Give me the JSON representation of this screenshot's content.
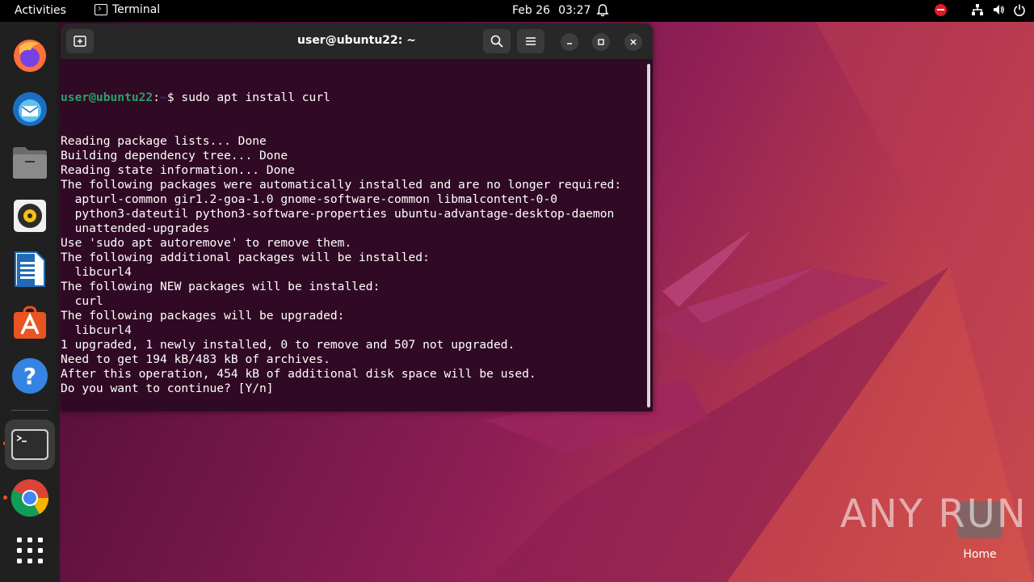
{
  "topbar": {
    "activities": "Activities",
    "app_name": "Terminal",
    "date": "Feb 26",
    "time": "03:27"
  },
  "dock": {
    "items": [
      "firefox-icon",
      "thunderbird-icon",
      "files-icon",
      "rhythmbox-icon",
      "libreoffice-writer-icon",
      "app-center-icon",
      "help-icon",
      "terminal-icon",
      "chrome-icon",
      "show-apps-icon"
    ]
  },
  "terminal": {
    "title": "user@ubuntu22: ~",
    "prompt_user": "user@ubuntu22",
    "prompt_sep": ":",
    "prompt_path": "~",
    "prompt_symbol": "$ ",
    "command": "sudo apt install curl",
    "output": [
      "Reading package lists... Done",
      "Building dependency tree... Done",
      "Reading state information... Done",
      "The following packages were automatically installed and are no longer required:",
      "  apturl-common gir1.2-goa-1.0 gnome-software-common libmalcontent-0-0",
      "  python3-dateutil python3-software-properties ubuntu-advantage-desktop-daemon",
      "  unattended-upgrades",
      "Use 'sudo apt autoremove' to remove them.",
      "The following additional packages will be installed:",
      "  libcurl4",
      "The following NEW packages will be installed:",
      "  curl",
      "The following packages will be upgraded:",
      "  libcurl4",
      "1 upgraded, 1 newly installed, 0 to remove and 507 not upgraded.",
      "Need to get 194 kB/483 kB of archives.",
      "After this operation, 454 kB of additional disk space will be used.",
      "Do you want to continue? [Y/n]"
    ]
  },
  "desktop": {
    "home_label": "Home",
    "watermark": "ANY RUN"
  }
}
